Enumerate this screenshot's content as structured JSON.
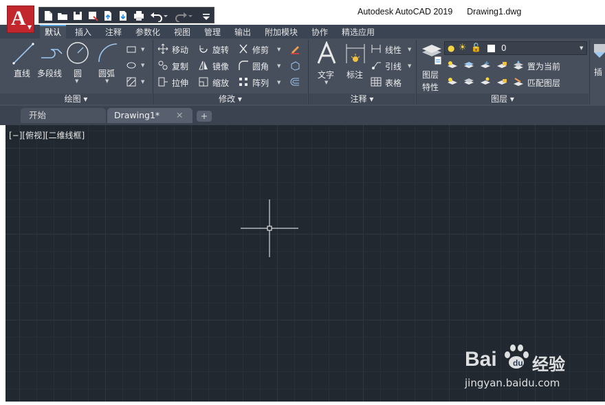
{
  "window": {
    "app_name": "Autodesk AutoCAD 2019",
    "document_name": "Drawing1.dwg",
    "logo_letter": "A"
  },
  "quick_access": {
    "icons": [
      "new-icon",
      "open-icon",
      "save-icon",
      "save-as-icon",
      "upload-icon",
      "download-icon",
      "print-icon",
      "undo-icon",
      "redo-icon",
      "customize-icon"
    ]
  },
  "ribbon_tabs": [
    "默认",
    "插入",
    "注释",
    "参数化",
    "视图",
    "管理",
    "输出",
    "附加模块",
    "协作",
    "精选应用"
  ],
  "ribbon": {
    "draw": {
      "title": "绘图",
      "line": "直线",
      "polyline": "多段线",
      "circle": "圆",
      "arc": "圆弧"
    },
    "modify": {
      "title": "修改",
      "move": "移动",
      "rotate": "旋转",
      "trim": "修剪",
      "copy": "复制",
      "mirror": "镜像",
      "fillet": "圆角",
      "stretch": "拉伸",
      "scale": "缩放",
      "array": "阵列"
    },
    "annotation": {
      "title": "注释",
      "text": "文字",
      "dimension": "标注",
      "linear": "线性",
      "leader": "引线",
      "table": "表格"
    },
    "layers": {
      "title": "图层",
      "layer_properties_line1": "图层",
      "layer_properties_line2": "特性",
      "current_layer": "0",
      "set_current": "置为当前",
      "match_layer": "匹配图层"
    },
    "insert_partial": "插"
  },
  "file_tabs": {
    "start": "开始",
    "drawing": "Drawing1*",
    "add": "+"
  },
  "viewport": {
    "label": "[−][俯视][二维线框]"
  },
  "watermark": {
    "brand": "Bai",
    "brand_suffix": "经验",
    "url": "jingyan.baidu.com"
  },
  "colors": {
    "accent": "#5aa0d8",
    "logo_red": "#c2272d",
    "canvas_bg": "#212830"
  }
}
